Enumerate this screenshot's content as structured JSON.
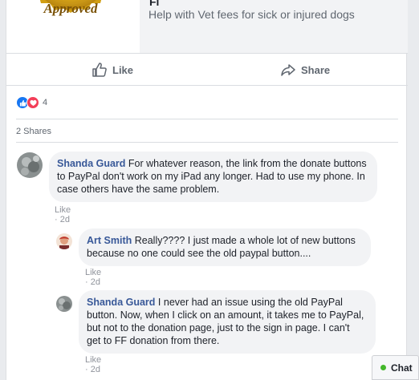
{
  "share_card": {
    "badge_text": "Approved",
    "title": "Fi",
    "description": "Help with Vet fees for sick or injured dogs"
  },
  "actions": {
    "like_label": "Like",
    "share_label": "Share"
  },
  "reactions": {
    "count": "4"
  },
  "shares_text": "2 Shares",
  "comments": [
    {
      "author": "Shanda Guard",
      "text": "For whatever reason, the link from the donate buttons to PayPal don't work on my iPad any longer. Had to use my phone. In case others have the same problem.",
      "like_label": "Like",
      "time": "2d"
    },
    {
      "author": "Art Smith",
      "text": "Really???? I just made a whole lot of new buttons because no one could see the old paypal button....",
      "like_label": "Like",
      "time": "2d"
    },
    {
      "author": "Shanda Guard",
      "text": "I never had an issue using the old PayPal button. Now, when I click on an amount, it takes me to PayPal, but not to the donation page, just to the sign in page. I can't get to FF donation from there.",
      "like_label": "Like",
      "time": "2d"
    }
  ],
  "chat": {
    "label": "Chat"
  },
  "colors": {
    "link_blue": "#385898",
    "like_blue": "#1877f2",
    "love_red": "#f33e58",
    "online_green": "#42b72a",
    "badge_gold": "#d4a017"
  },
  "icons": [
    "badge-seal-icon",
    "thumbs-up-icon",
    "share-arrow-icon",
    "like-reaction-icon",
    "love-reaction-icon",
    "avatar-icon",
    "online-dot-icon"
  ]
}
